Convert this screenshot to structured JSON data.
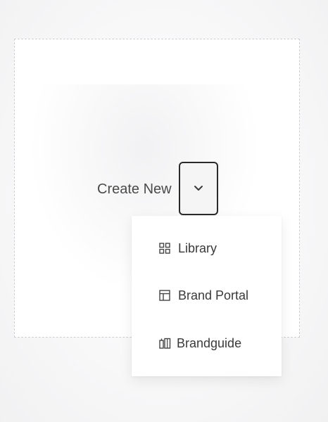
{
  "create": {
    "label": "Create New",
    "toggle_icon": "chevron-down-icon"
  },
  "menu": {
    "items": [
      {
        "label": "Library",
        "icon": "grid-icon"
      },
      {
        "label": "Brand Portal",
        "icon": "layout-icon"
      },
      {
        "label": "Brandguide",
        "icon": "book-icon"
      }
    ]
  },
  "colors": {
    "text": "#3a3a3a",
    "border": "#2a2a2a",
    "dashed_border": "#cfcfd2",
    "background": "#f3f3f4"
  }
}
